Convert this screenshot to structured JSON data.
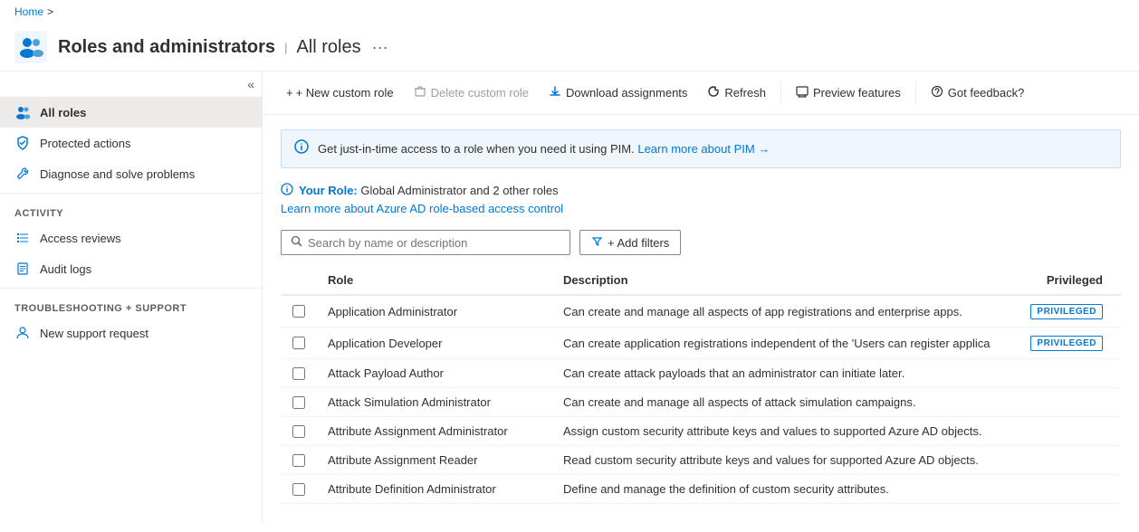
{
  "breadcrumb": {
    "home": "Home",
    "separator": ">"
  },
  "page": {
    "title": "Roles and administrators",
    "separator": "|",
    "subtitle": "All roles",
    "more_label": "···"
  },
  "toolbar": {
    "new_custom_role": "+ New custom role",
    "delete_custom_role": "Delete custom role",
    "download_assignments": "Download assignments",
    "refresh": "Refresh",
    "preview_features": "Preview features",
    "got_feedback": "Got feedback?"
  },
  "sidebar": {
    "collapse_tooltip": "Collapse",
    "items": [
      {
        "id": "all-roles",
        "label": "All roles",
        "active": true,
        "icon": "roles-icon"
      },
      {
        "id": "protected-actions",
        "label": "Protected actions",
        "active": false,
        "icon": "shield-icon"
      },
      {
        "id": "diagnose-solve",
        "label": "Diagnose and solve problems",
        "active": false,
        "icon": "wrench-icon"
      }
    ],
    "activity_section": "Activity",
    "activity_items": [
      {
        "id": "access-reviews",
        "label": "Access reviews",
        "icon": "list-icon"
      },
      {
        "id": "audit-logs",
        "label": "Audit logs",
        "icon": "doc-icon"
      }
    ],
    "support_section": "Troubleshooting + Support",
    "support_items": [
      {
        "id": "new-support-request",
        "label": "New support request",
        "icon": "person-icon"
      }
    ]
  },
  "info_banner": {
    "text": "Get just-in-time access to a role when you need it using PIM. Learn more about PIM",
    "link_text": "Learn more about PIM",
    "arrow": "→"
  },
  "role_info": {
    "label": "Your Role:",
    "value": "Global Administrator and 2 other roles",
    "link_text": "Learn more about Azure AD role-based access control"
  },
  "search": {
    "placeholder": "Search by name or description"
  },
  "add_filter_label": "+ Add filters",
  "table": {
    "columns": [
      "",
      "Role",
      "Description",
      "Privileged"
    ],
    "rows": [
      {
        "role": "Application Administrator",
        "description": "Can create and manage all aspects of app registrations and enterprise apps.",
        "privileged": true
      },
      {
        "role": "Application Developer",
        "description": "Can create application registrations independent of the 'Users can register applica",
        "privileged": true
      },
      {
        "role": "Attack Payload Author",
        "description": "Can create attack payloads that an administrator can initiate later.",
        "privileged": false
      },
      {
        "role": "Attack Simulation Administrator",
        "description": "Can create and manage all aspects of attack simulation campaigns.",
        "privileged": false
      },
      {
        "role": "Attribute Assignment Administrator",
        "description": "Assign custom security attribute keys and values to supported Azure AD objects.",
        "privileged": false
      },
      {
        "role": "Attribute Assignment Reader",
        "description": "Read custom security attribute keys and values for supported Azure AD objects.",
        "privileged": false
      },
      {
        "role": "Attribute Definition Administrator",
        "description": "Define and manage the definition of custom security attributes.",
        "privileged": false
      }
    ],
    "privileged_badge": "PRIVILEGED"
  }
}
